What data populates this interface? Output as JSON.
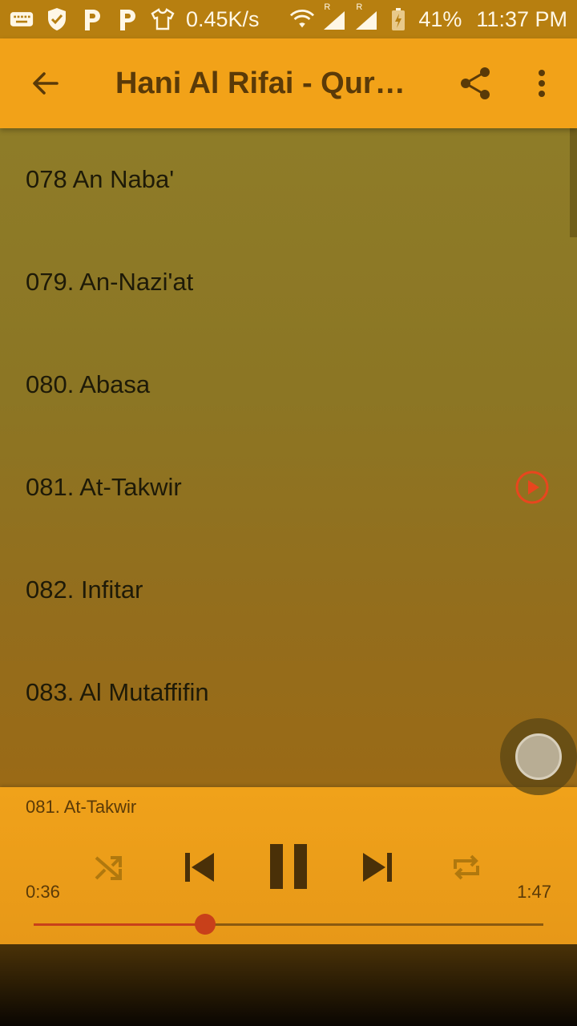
{
  "status_bar": {
    "net_speed": "0.45K/s",
    "battery": "41%",
    "time": "11:37 PM",
    "sim1": "R",
    "sim2": "R",
    "icons": [
      "keyboard-icon",
      "shield-icon",
      "p-icon",
      "p-icon",
      "tshirt-icon",
      "wifi-icon",
      "signal-icon",
      "signal-icon",
      "battery-icon"
    ]
  },
  "app_bar": {
    "title": "Hani Al Rifai - Quran Offline",
    "back_icon": "arrow-back-icon",
    "share_icon": "share-icon",
    "more_icon": "more-vert-icon"
  },
  "tracks": [
    {
      "label": "078 An Naba'",
      "playing": false
    },
    {
      "label": "079. An-Nazi'at",
      "playing": false
    },
    {
      "label": "080. Abasa",
      "playing": false
    },
    {
      "label": "081. At-Takwir",
      "playing": true
    },
    {
      "label": "082. Infitar",
      "playing": false
    },
    {
      "label": "083. Al Mutaffifin",
      "playing": false
    }
  ],
  "player": {
    "now_playing": "081. At-Takwir",
    "elapsed": "0:36",
    "duration": "1:47",
    "progress_fraction": 0.336,
    "controls": [
      "shuffle-icon",
      "skip-previous-icon",
      "pause-icon",
      "skip-next-icon",
      "repeat-icon"
    ]
  },
  "colors": {
    "accent": "#f2a218",
    "progress": "#c8401a",
    "play_indicator": "#e8461e"
  }
}
